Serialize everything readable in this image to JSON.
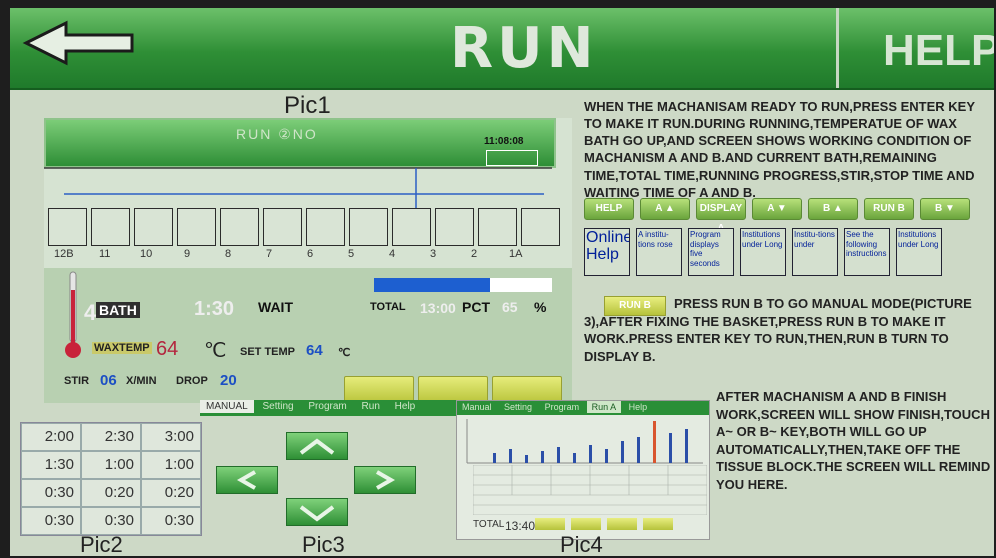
{
  "header": {
    "title": "RUN",
    "help": "HELP"
  },
  "labels": {
    "pic1": "Pic1",
    "pic2": "Pic2",
    "pic3": "Pic3",
    "pic4": "Pic4"
  },
  "pic1": {
    "top_text": "RUN  ②NO",
    "clock": "11:08:08",
    "bath_numbers": [
      "12B",
      "11",
      "10",
      "9",
      "8",
      "7",
      "6",
      "5",
      "4",
      "3",
      "2",
      "1A"
    ],
    "current": "4",
    "bath_label": "BATH",
    "time": "1:30",
    "wait": "WAIT",
    "total": "TOTAL",
    "total_time": "13:00",
    "pct_label": "PCT",
    "pct_value": "65",
    "pct_unit": "%",
    "progress_fraction": 0.65,
    "wax_temp_label": "WAXTEMP",
    "wax_temp": "64",
    "wax_unit": "℃",
    "set_temp_label": "SET TEMP",
    "set_temp": "64",
    "set_temp_unit": "℃",
    "stir_label": "STIR",
    "stir": "06",
    "stir_unit": "X/MIN",
    "drop_label": "DROP",
    "drop": "20"
  },
  "instructions": {
    "main": "WHEN THE MACHANISAM READY TO RUN,PRESS ENTER KEY TO MAKE IT RUN.DURING RUNNING,TEMPERATUE OF WAX BATH GO UP,AND SCREEN SHOWS WORKING CONDITION OF MACHANISM A AND B.AND CURRENT BATH,REMAINING TIME,TOTAL TIME,RUNNING PROGRESS,STIR,STOP TIME AND WAITING TIME OF A AND B.",
    "buttons": [
      "HELP",
      "A ▲",
      "DISPLAY A",
      "A ▼",
      "B ▲",
      "RUN B",
      "B ▼"
    ],
    "descriptions": [
      "Online Help",
      "A institu-tions rose",
      "Program displays five seconds",
      "Institutions under Long",
      "Institu-tions under",
      "See the following instructions",
      "Institutions under Long"
    ],
    "runb_button": "RUN B",
    "runb_text": "PRESS RUN B TO GO MANUAL MODE(PICTURE 3),AFTER FIXING THE BASKET,PRESS RUN B TO MAKE IT WORK.PRESS ENTER KEY TO RUN,THEN,RUN B TURN TO DISPLAY B.",
    "finish_text": "AFTER MACHANISM A AND B FINISH WORK,SCREEN WILL SHOW FINISH,TOUCH A~ OR B~ KEY,BOTH WILL GO UP AUTOMATICALLY,THEN,TAKE OFF THE TISSUE BLOCK.THE SCREEN WILL REMIND YOU HERE."
  },
  "pic2": {
    "cells": [
      "2:00",
      "2:30",
      "3:00",
      "1:30",
      "1:00",
      "1:00",
      "0:30",
      "0:20",
      "0:20",
      "0:30",
      "0:30",
      "0:30"
    ]
  },
  "pic3": {
    "tabs": [
      "MANUAL",
      "Setting",
      "Program",
      "Run",
      "Help"
    ]
  },
  "pic4": {
    "tabs": [
      "Manual",
      "Setting",
      "Program",
      "Run A",
      "Help"
    ],
    "total_label": "TOTAL",
    "total": "13:40"
  },
  "colors": {
    "topbar": "#2f8f36",
    "screen": "#cdd9c6",
    "progress": "#1d5fd0",
    "wax_temp": "#b3263e"
  }
}
